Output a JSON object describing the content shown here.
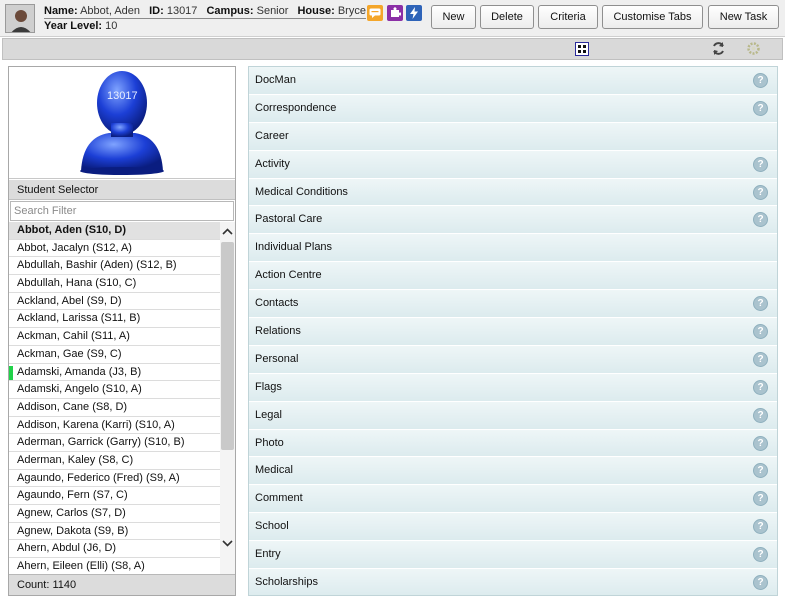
{
  "header": {
    "name_label": "Name:",
    "name_value": "Abbot, Aden",
    "id_label": "ID:",
    "id_value": "13017",
    "campus_label": "Campus:",
    "campus_value": "Senior",
    "house_label": "House:",
    "house_value": "Bryce",
    "year_label": "Year Level:",
    "year_value": "10",
    "icons": [
      {
        "name": "message-icon",
        "color": "#f4a62a"
      },
      {
        "name": "puzzle-icon",
        "color": "#8b2fa6"
      },
      {
        "name": "lightning-icon",
        "color": "#2e63b8"
      }
    ],
    "buttons": {
      "new": "New",
      "delete": "Delete",
      "criteria": "Criteria",
      "customise_tabs": "Customise Tabs",
      "new_task": "New Task"
    }
  },
  "toolbar": {
    "icons": [
      "grid-toggle-icon",
      "refresh-icon",
      "settings-gear-icon"
    ]
  },
  "photo": {
    "id_overlay": "13017"
  },
  "student_selector": {
    "title": "Student Selector",
    "search_placeholder": "Search Filter",
    "selected": "Abbot, Aden (S10, D)",
    "items": [
      "Abbot, Jacalyn (S12, A)",
      "Abdullah, Bashir (Aden) (S12, B)",
      "Abdullah, Hana (S10, C)",
      "Ackland, Abel (S9, D)",
      "Ackland, Larissa (S11, B)",
      "Ackman, Cahil (S11, A)",
      "Ackman, Gae (S9, C)",
      "Adamski, Amanda (J3, B)",
      "Adamski, Angelo (S10, A)",
      "Addison, Cane (S8, D)",
      "Addison, Karena (Karri) (S10, A)",
      "Aderman, Garrick (Garry) (S10, B)",
      "Aderman, Kaley (S8, C)",
      "Agaundo, Federico (Fred) (S9, A)",
      "Agaundo, Fern (S7, C)",
      "Agnew, Carlos (S7, D)",
      "Agnew, Dakota (S9, B)",
      "Ahern, Abdul (J6, D)",
      "Ahern, Eileen (Elli) (S8, A)"
    ],
    "flag_color": "#21d24a",
    "count": "Count: 1140"
  },
  "sections": [
    {
      "label": "DocMan",
      "help": "?"
    },
    {
      "label": "Correspondence",
      "help": "?"
    },
    {
      "label": "Career",
      "help": ""
    },
    {
      "label": "Activity",
      "help": "?"
    },
    {
      "label": "Medical Conditions",
      "help": "?"
    },
    {
      "label": "Pastoral Care",
      "help": "?"
    },
    {
      "label": "Individual Plans",
      "help": ""
    },
    {
      "label": "Action Centre",
      "help": ""
    },
    {
      "label": "Contacts",
      "help": "?"
    },
    {
      "label": "Relations",
      "help": "?"
    },
    {
      "label": "Personal",
      "help": "?"
    },
    {
      "label": "Flags",
      "help": "?"
    },
    {
      "label": "Legal",
      "help": "?"
    },
    {
      "label": "Photo",
      "help": "?"
    },
    {
      "label": "Medical",
      "help": "?"
    },
    {
      "label": "Comment",
      "help": "?"
    },
    {
      "label": "School",
      "help": "?"
    },
    {
      "label": "Entry",
      "help": "?"
    },
    {
      "label": "Scholarships",
      "help": "?"
    }
  ]
}
